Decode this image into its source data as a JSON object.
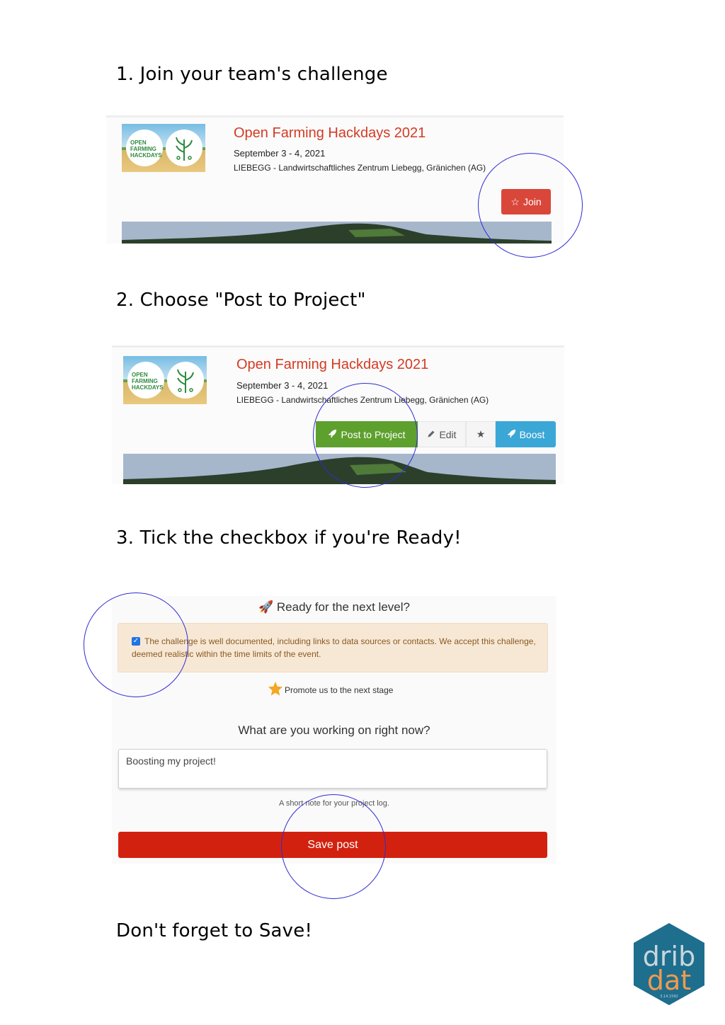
{
  "steps": {
    "step1": "1. Join your team's challenge",
    "step2": "2. Choose \"Post to Project\"",
    "step3": "3. Tick the checkbox if you're Ready!",
    "final": "Don't forget to Save!"
  },
  "event": {
    "logo_text": "OPEN FARMING HACKDAYS",
    "title": "Open Farming Hackdays 2021",
    "date": "September 3 - 4, 2021",
    "location": "LIEBEGG - Landwirtschaftliches Zentrum Liebegg, Gränichen (AG)"
  },
  "buttons": {
    "join": "Join",
    "post_to_project": "Post to Project",
    "edit": "Edit",
    "boost": "Boost"
  },
  "icons": {
    "join": "star-outline-icon",
    "post": "rocket-icon",
    "edit": "pencil-icon",
    "star": "star-icon",
    "boost": "rocket-icon"
  },
  "form": {
    "ready_heading": "🚀 Ready for the next level?",
    "checkbox_checked": true,
    "checkbox_text": "The challenge is well documented, including links to data sources or contacts. We accept this challenge, deemed realistic within the time limits of the event.",
    "promote_text": "Promote us to the next stage",
    "working_heading": "What are you working on right now?",
    "textarea_value": "Boosting my project!",
    "help_text": "A short note for your project log.",
    "save_label": "Save post"
  },
  "brand": {
    "logo_line1": "drib",
    "logo_line2": "dat",
    "logo_small": "3.14.1592"
  },
  "colors": {
    "highlight_circle": "#2f2bd4",
    "join_button": "#d9473a",
    "post_button": "#5ea02e",
    "boost_button": "#3aa7d6",
    "save_button": "#d2220f",
    "event_title": "#d33b24"
  }
}
